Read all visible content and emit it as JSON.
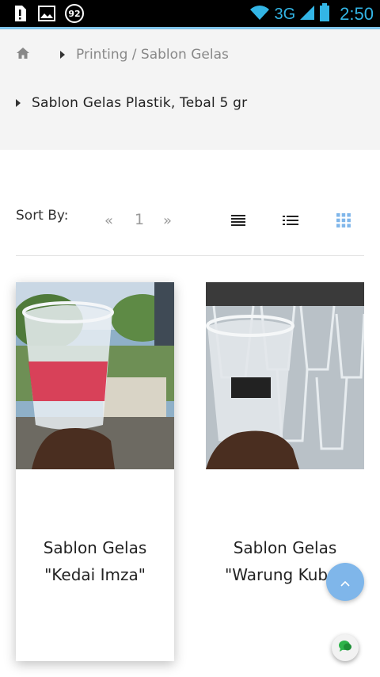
{
  "status_bar": {
    "notification_badge": "92",
    "network": "3G",
    "time": "2:50",
    "accent_color": "#33b5e5"
  },
  "breadcrumb": {
    "home_icon": "home-icon",
    "category": "Printing / Sablon Gelas",
    "product": "Sablon Gelas Plastik, Tebal 5 gr"
  },
  "toolbar": {
    "sort_label": "Sort By:",
    "prev": "«",
    "page": "1",
    "next": "»",
    "view_modes": [
      "list-compact-icon",
      "list-detail-icon",
      "grid-icon"
    ],
    "active_view": "grid-icon",
    "active_color": "#7fb6ea"
  },
  "products": [
    {
      "title_line1": "Sablon Gelas",
      "title_line2": "\"Kedai Imza\"",
      "image": "photo of printed plastic cup held in hand"
    },
    {
      "title_line1": "Sablon Gelas",
      "title_line2": "\"Warung Kubu\"",
      "image": "photo of printed plastic cups"
    }
  ],
  "floating": {
    "scroll_top_icon": "chevron-up-icon",
    "chat_icon": "chat-icon"
  }
}
